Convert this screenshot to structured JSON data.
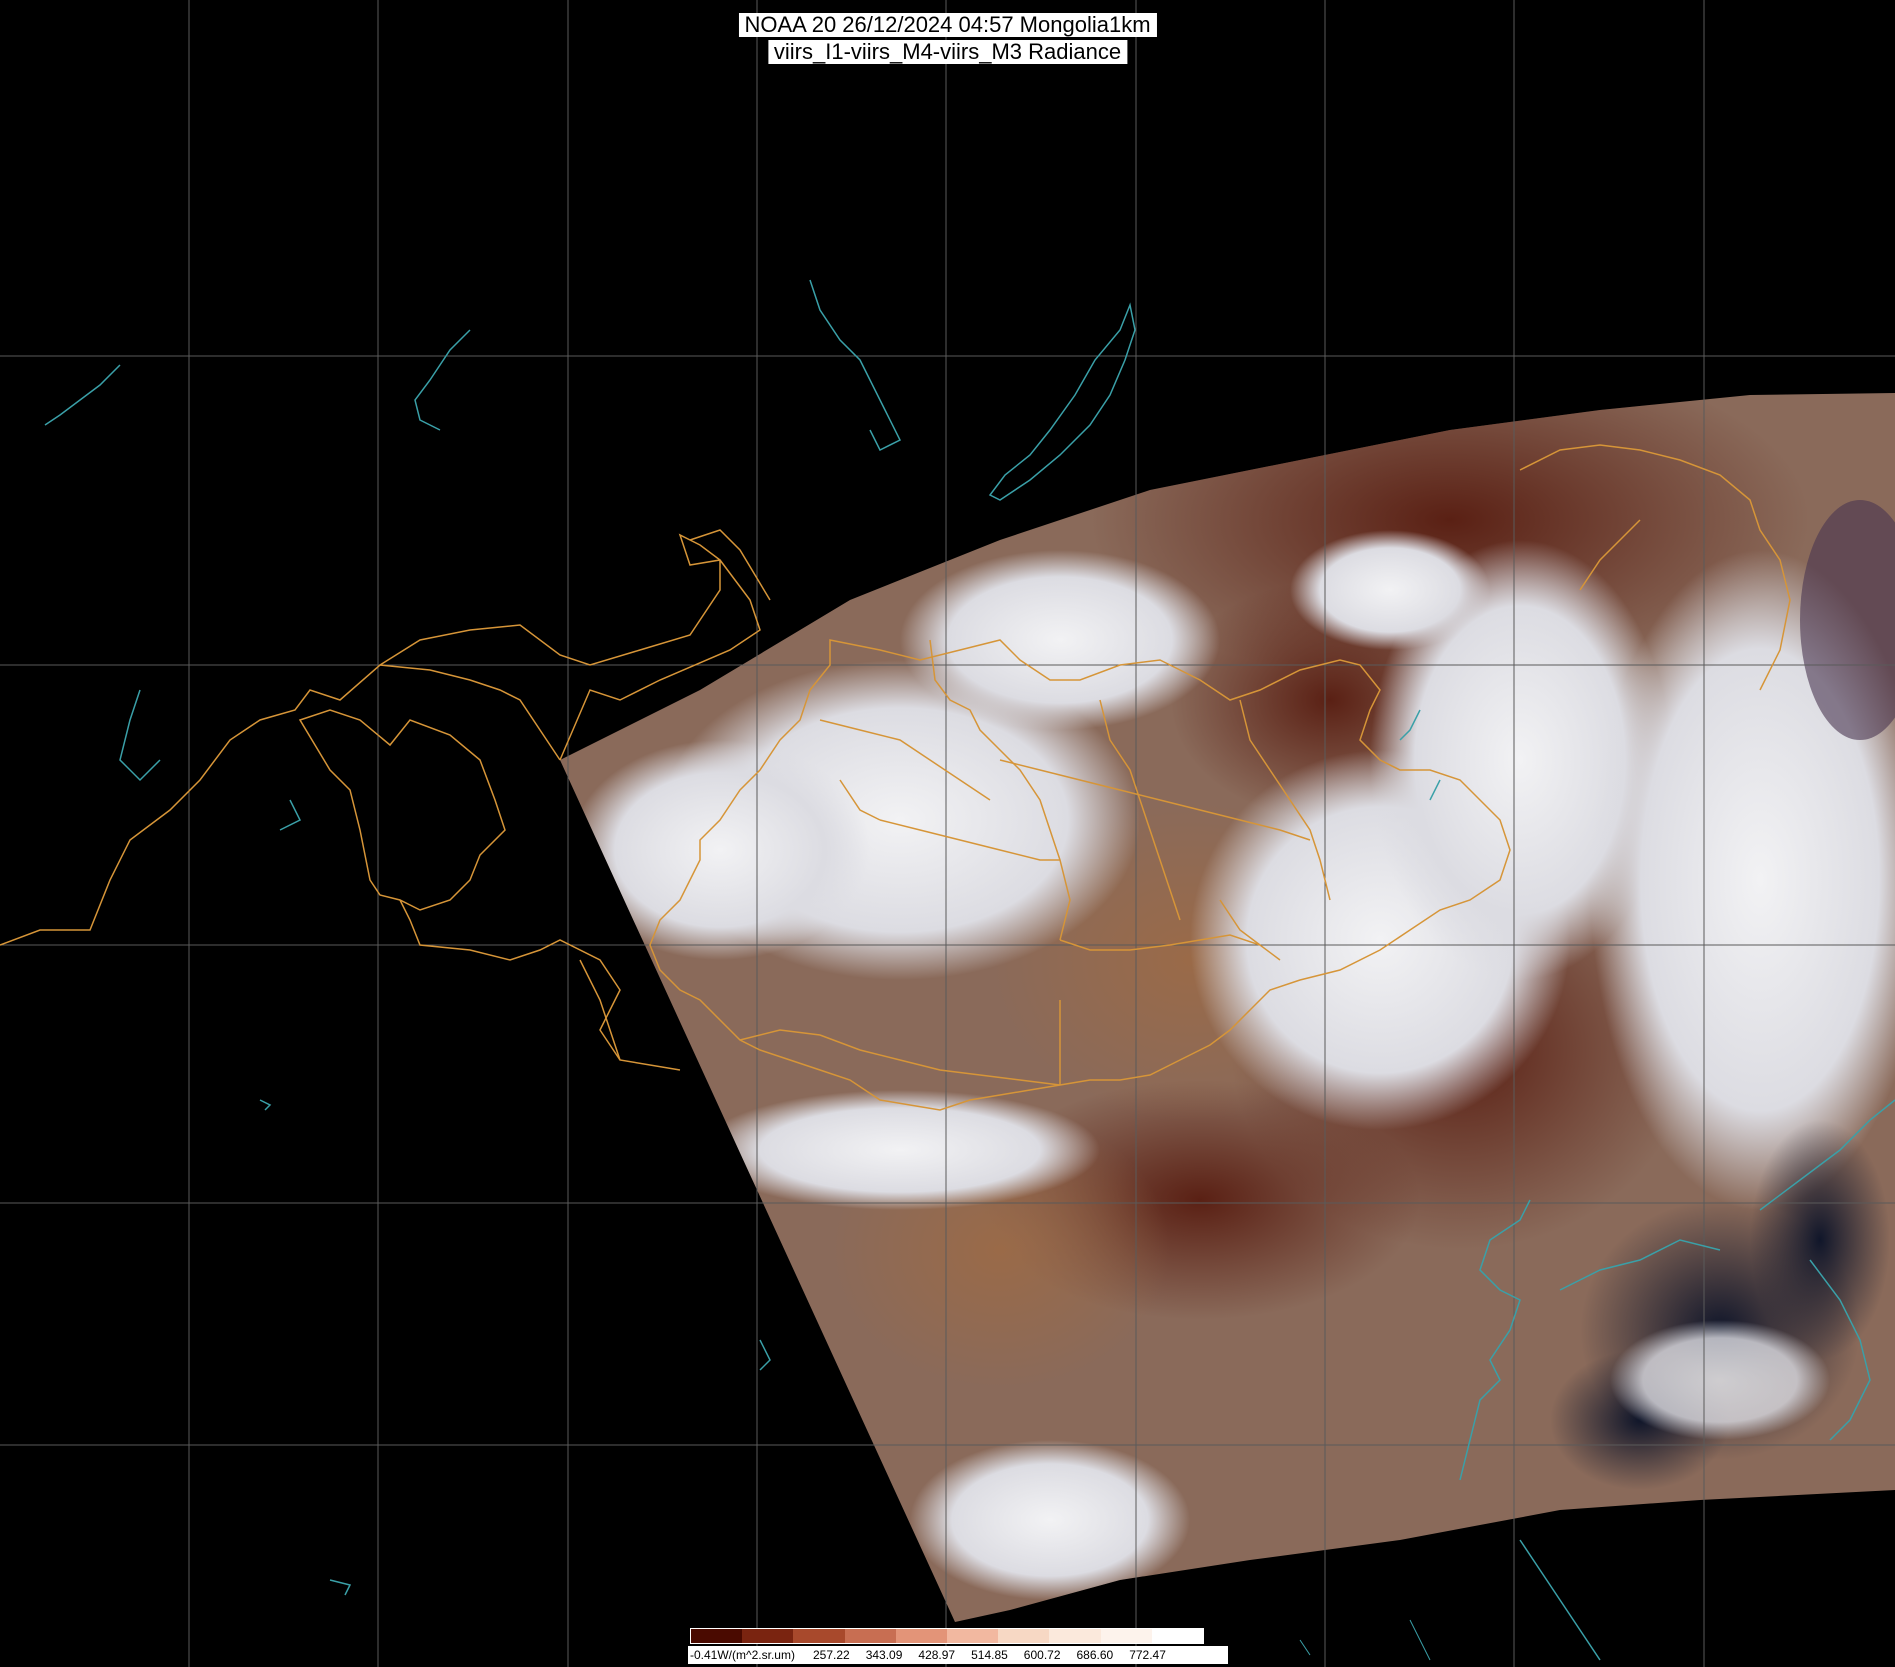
{
  "title": {
    "line1": "NOAA 20 26/12/2024 04:57 Mongolia1km",
    "line2": "viirs_I1-viirs_M4-viirs_M3 Radiance"
  },
  "colorbar": {
    "unit_label": "-0.41W/(m^2.sr.um)",
    "tick_values": [
      "257.22",
      "343.09",
      "428.97",
      "514.85",
      "600.72",
      "686.60",
      "772.47"
    ],
    "colors": [
      "#4a0a00",
      "#7a2410",
      "#a8492c",
      "#c86e52",
      "#e39478",
      "#f2b8a0",
      "#f7d8c4",
      "#fbe9dc",
      "#fdf3ec",
      "#ffffff"
    ]
  },
  "colors": {
    "background": "#000000",
    "grid": "#5a5a5a",
    "border": "#d69538",
    "coast": "#3aa0a8"
  }
}
